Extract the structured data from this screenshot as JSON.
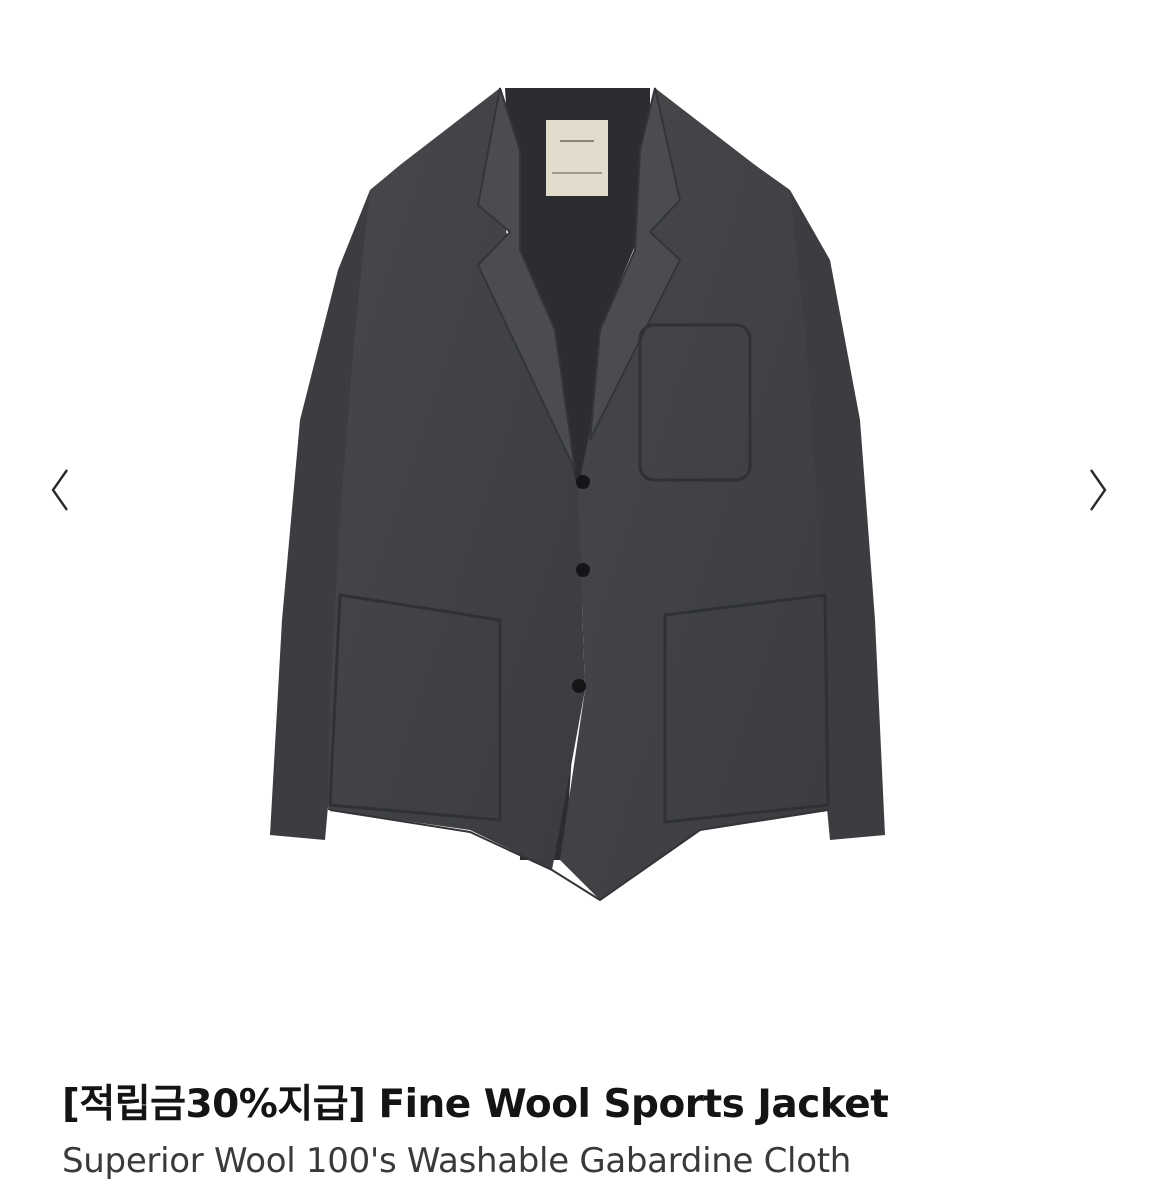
{
  "gallery": {
    "prev_icon": "chevron-left-icon",
    "next_icon": "chevron-right-icon",
    "image_alt": "Fine Wool Sports Jacket"
  },
  "product": {
    "title": "[적립금30%지급] Fine Wool Sports Jacket",
    "subtitle": "Superior Wool 100's Washable Gabardine Cloth"
  },
  "colors": {
    "jacket": "#3f4144",
    "background": "#ffffff",
    "title_text": "#141414",
    "subtitle_text": "#3a3a3a"
  }
}
